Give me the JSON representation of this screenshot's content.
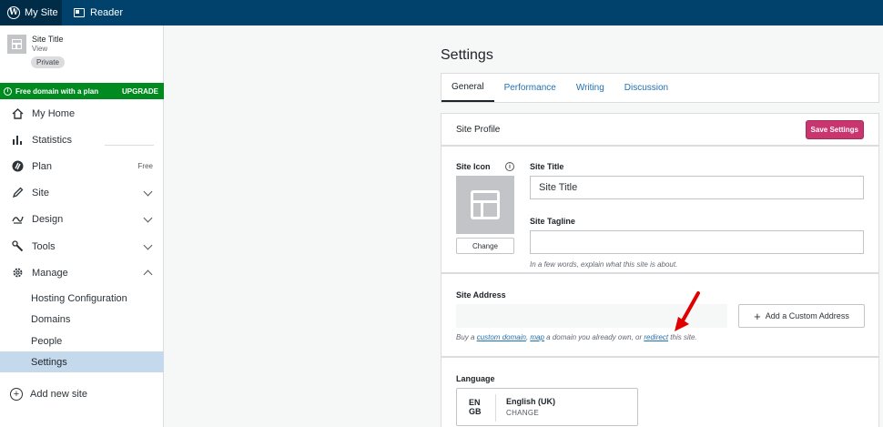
{
  "topbar": {
    "my_site": "My Site",
    "reader": "Reader"
  },
  "site_card": {
    "title": "Site Title",
    "view": "View",
    "badge": "Private"
  },
  "promo": {
    "text": "Free domain with a plan",
    "action": "UPGRADE"
  },
  "nav": [
    {
      "label": "My Home",
      "icon": "home-icon"
    },
    {
      "label": "Statistics",
      "icon": "stats-icon"
    },
    {
      "label": "Plan",
      "icon": "plan-icon",
      "right": "Free"
    },
    {
      "label": "Site",
      "icon": "pencil-icon"
    },
    {
      "label": "Design",
      "icon": "design-icon"
    },
    {
      "label": "Tools",
      "icon": "wrench-icon"
    },
    {
      "label": "Manage",
      "icon": "gear-icon"
    }
  ],
  "manage_sub": [
    "Hosting Configuration",
    "Domains",
    "People",
    "Settings"
  ],
  "add_site": "Add new site",
  "page": {
    "title": "Settings",
    "tabs": [
      "General",
      "Performance",
      "Writing",
      "Discussion"
    ]
  },
  "site_profile": {
    "header": "Site Profile",
    "save": "Save Settings",
    "site_icon_label": "Site Icon",
    "change": "Change",
    "site_title_label": "Site Title",
    "site_title_value": "Site Title",
    "tagline_label": "Site Tagline",
    "tagline_value": "",
    "tagline_hint": "In a few words, explain what this site is about."
  },
  "site_address": {
    "label": "Site Address",
    "add_custom": "Add a Custom Address",
    "hint_pre": "Buy a ",
    "link_custom_domain": "custom domain",
    "hint_mid1": ", ",
    "link_map": "map",
    "hint_mid2": " a domain you already own, or ",
    "link_redirect": "redirect",
    "hint_post": " this site."
  },
  "language": {
    "label": "Language",
    "code_top": "EN",
    "code_bottom": "GB",
    "name": "English (UK)",
    "change": "CHANGE"
  },
  "colors": {
    "topbar": "#00426b",
    "promo": "#008a20",
    "save": "#c9356e",
    "active": "#c5d9ed",
    "arrow": "#e00000"
  }
}
